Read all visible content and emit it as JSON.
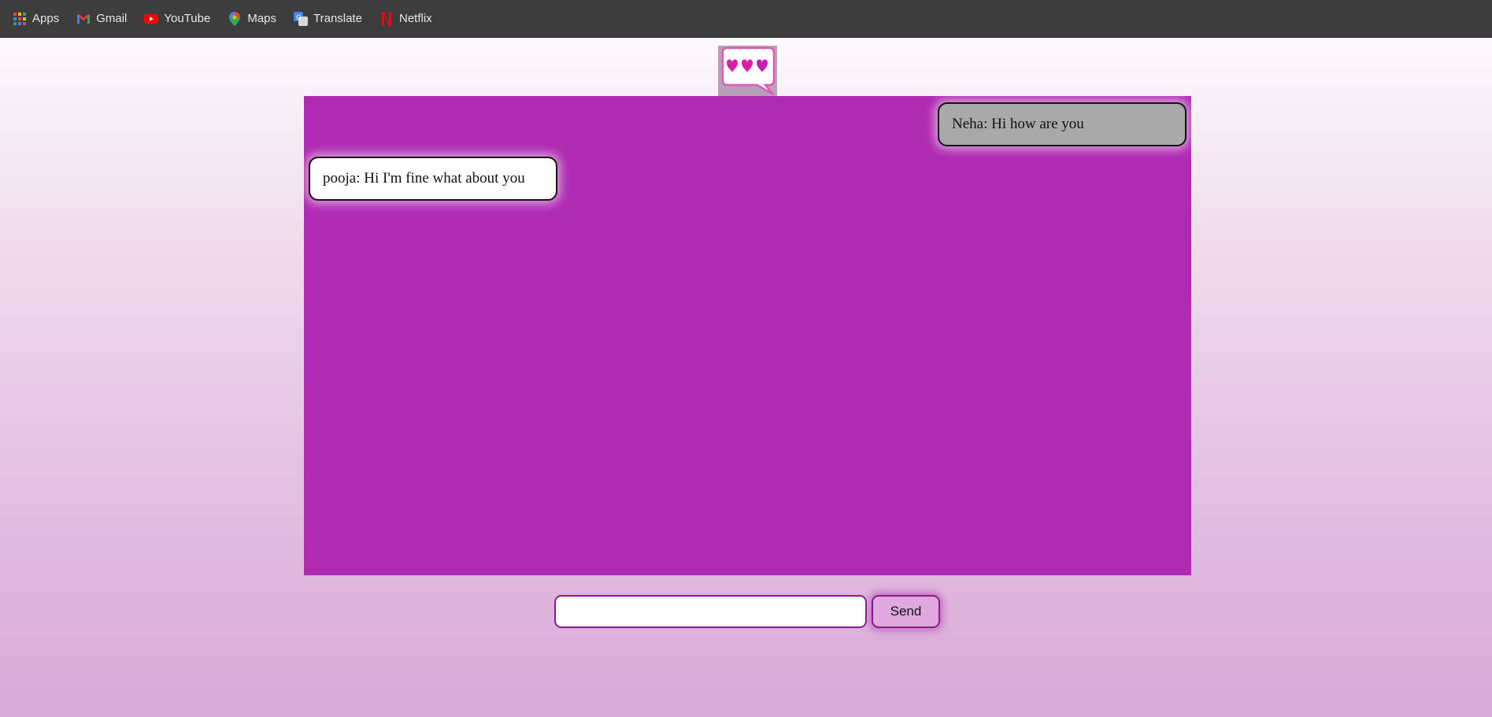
{
  "bookmarks": [
    {
      "label": "Apps",
      "icon": "apps-grid-icon"
    },
    {
      "label": "Gmail",
      "icon": "gmail-icon"
    },
    {
      "label": "YouTube",
      "icon": "youtube-icon"
    },
    {
      "label": "Maps",
      "icon": "maps-pin-icon"
    },
    {
      "label": "Translate",
      "icon": "translate-icon"
    },
    {
      "label": "Netflix",
      "icon": "netflix-icon"
    }
  ],
  "logo": {
    "icon": "chat-bubble-hearts-icon"
  },
  "chat": {
    "messages": [
      {
        "text": "Neha: Hi how are you",
        "side": "right"
      },
      {
        "text": "pooja: Hi I'm fine what about you",
        "side": "left"
      }
    ]
  },
  "composer": {
    "input_value": "",
    "input_placeholder": "",
    "send_label": "Send"
  },
  "colors": {
    "chat_bg": "#af2cb2",
    "toolbar_bg": "#3c3c3c",
    "accent": "#8a1b8c"
  }
}
